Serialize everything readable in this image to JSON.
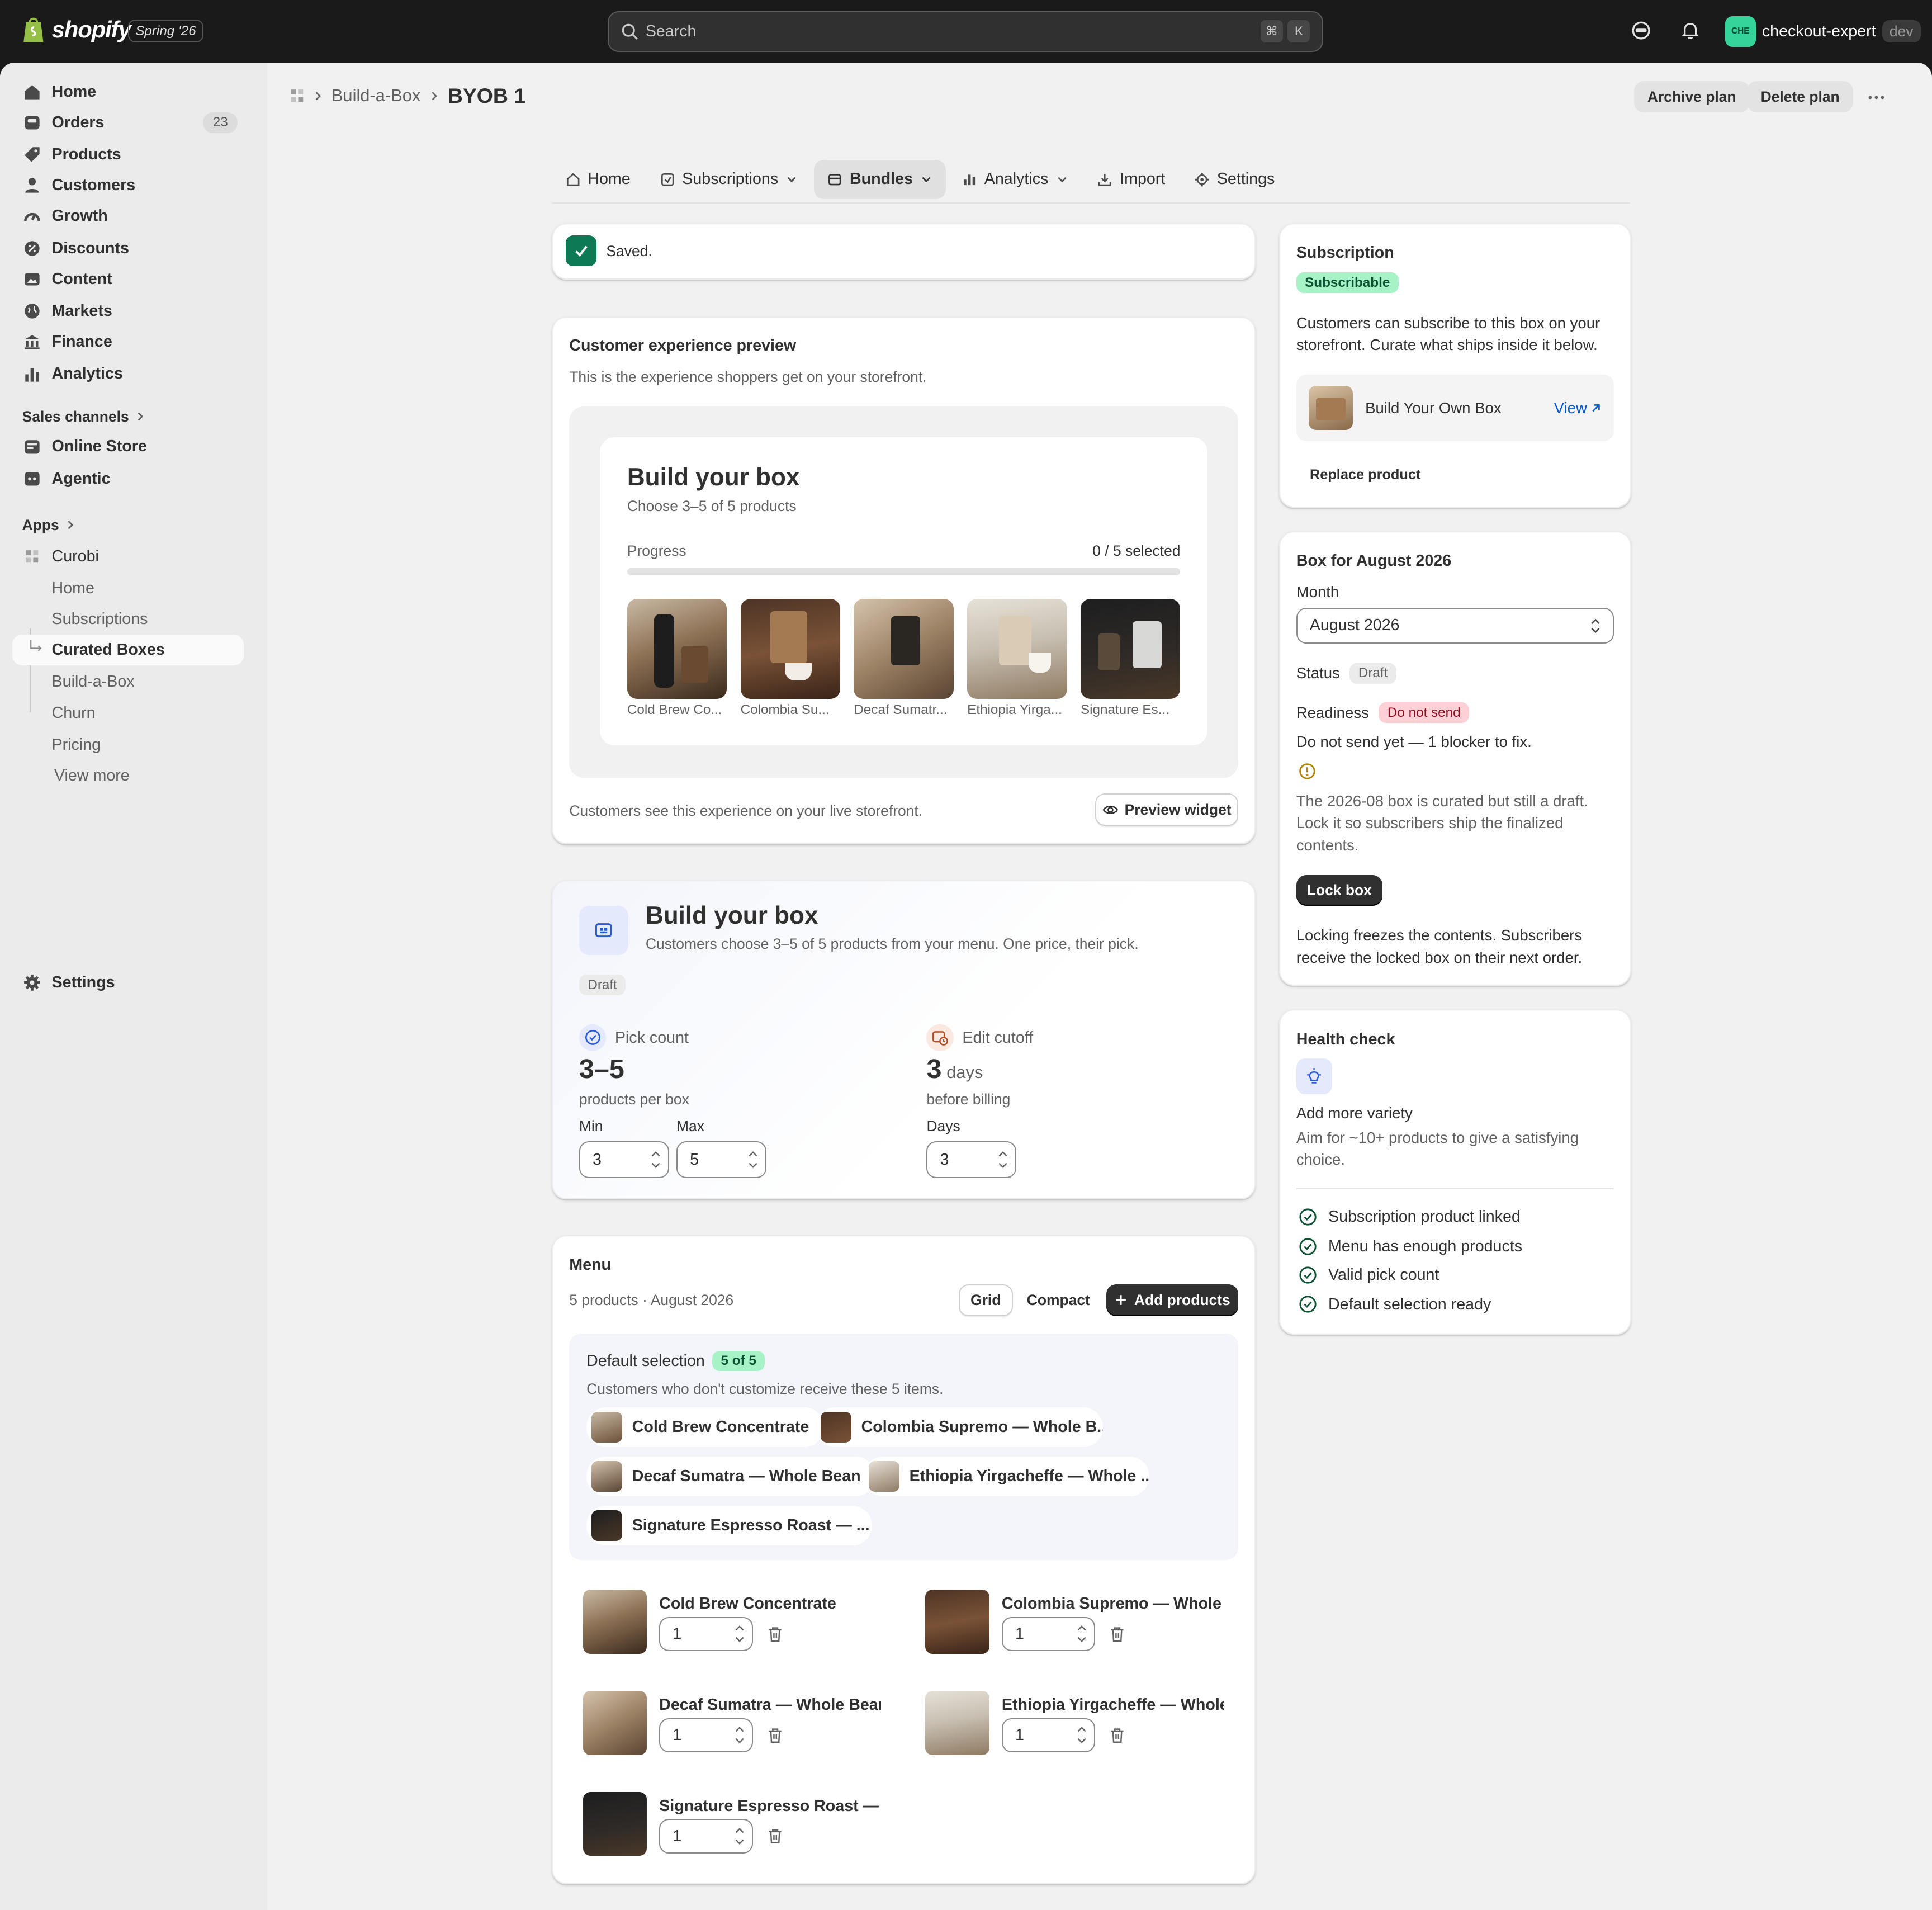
{
  "topbar": {
    "logo_text": "shopify",
    "edition": "Spring '26",
    "search_placeholder": "Search",
    "kbd1": "⌘",
    "kbd2": "K",
    "store_initials": "CHE",
    "store_name": "checkout-expert",
    "store_env": "dev"
  },
  "sidebar": {
    "items": [
      {
        "label": "Home",
        "icon": "home-icon"
      },
      {
        "label": "Orders",
        "icon": "inbox-icon",
        "count": "23"
      },
      {
        "label": "Products",
        "icon": "tag-icon"
      },
      {
        "label": "Customers",
        "icon": "person-icon"
      },
      {
        "label": "Growth",
        "icon": "gauge-icon"
      },
      {
        "label": "Discounts",
        "icon": "discount-icon"
      },
      {
        "label": "Content",
        "icon": "content-icon"
      },
      {
        "label": "Markets",
        "icon": "globe-icon"
      },
      {
        "label": "Finance",
        "icon": "bank-icon"
      },
      {
        "label": "Analytics",
        "icon": "bar-chart-icon"
      }
    ],
    "sales_channels_label": "Sales channels",
    "channels": [
      {
        "label": "Online Store",
        "icon": "store-icon"
      },
      {
        "label": "Agentic",
        "icon": "agentic-icon"
      }
    ],
    "apps_label": "Apps",
    "app_name": "Curobi",
    "app_items": [
      "Home",
      "Subscriptions",
      "Curated Boxes",
      "Build-a-Box",
      "Churn",
      "Pricing",
      "View more"
    ],
    "settings_label": "Settings"
  },
  "header": {
    "breadcrumb_parent": "Build-a-Box",
    "title": "BYOB 1",
    "archive_label": "Archive plan",
    "delete_label": "Delete plan"
  },
  "tabs": [
    {
      "label": "Home",
      "icon": "home-outline-icon",
      "dropdown": false
    },
    {
      "label": "Subscriptions",
      "icon": "subscriptions-icon",
      "dropdown": true
    },
    {
      "label": "Bundles",
      "icon": "bundles-icon",
      "dropdown": true,
      "active": true
    },
    {
      "label": "Analytics",
      "icon": "analytics-icon",
      "dropdown": true
    },
    {
      "label": "Import",
      "icon": "import-icon",
      "dropdown": false
    },
    {
      "label": "Settings",
      "icon": "settings-outline-icon",
      "dropdown": false
    }
  ],
  "saved": {
    "text": "Saved."
  },
  "preview": {
    "title": "Customer experience preview",
    "subtitle": "This is the experience shoppers get on your storefront.",
    "widget_title": "Build your box",
    "widget_sub": "Choose 3–5 of 5 products",
    "progress_label": "Progress",
    "progress_count": "0 / 5 selected",
    "progress_value": 0,
    "products": [
      "Cold Brew Co...",
      "Colombia Su...",
      "Decaf Sumatr...",
      "Ethiopia Yirga...",
      "Signature Es..."
    ],
    "footer": "Customers see this experience on your live storefront.",
    "preview_button": "Preview widget"
  },
  "box": {
    "title": "Build your box",
    "subtitle": "Customers choose 3–5 of 5 products from your menu. One price, their pick.",
    "status": "Draft",
    "pick_label": "Pick count",
    "pick_value": "3–5",
    "pick_sub": "products per box",
    "min_label": "Min",
    "min_value": "3",
    "max_label": "Max",
    "max_value": "5",
    "cutoff_label": "Edit cutoff",
    "cutoff_value": "3",
    "cutoff_unit": "days",
    "cutoff_sub": "before billing",
    "days_label": "Days",
    "days_value": "3"
  },
  "menu": {
    "title": "Menu",
    "subtitle": "5 products · August 2026",
    "grid_label": "Grid",
    "compact_label": "Compact",
    "add_label": "Add products",
    "default_title": "Default selection",
    "default_badge": "5 of 5",
    "default_desc": "Customers who don't customize receive these 5 items.",
    "chips": [
      "Cold Brew Concentrate",
      "Colombia Supremo — Whole B...",
      "Decaf Sumatra — Whole Bean",
      "Ethiopia Yirgacheffe — Whole ...",
      "Signature Espresso Roast — ..."
    ],
    "items": [
      {
        "name": "Cold Brew Concentrate",
        "qty": "1"
      },
      {
        "name": "Colombia Supremo — Whole ...",
        "qty": "1"
      },
      {
        "name": "Decaf Sumatra — Whole Bean",
        "qty": "1"
      },
      {
        "name": "Ethiopia Yirgacheffe — Whole...",
        "qty": "1"
      },
      {
        "name": "Signature Espresso Roast — ...",
        "qty": "1"
      }
    ]
  },
  "subscription": {
    "title": "Subscription",
    "badge": "Subscribable",
    "desc": "Customers can subscribe to this box on your storefront. Curate what ships inside it below.",
    "product": "Build Your Own Box",
    "view": "View",
    "replace": "Replace product"
  },
  "month_box": {
    "title": "Box for August 2026",
    "month_label": "Month",
    "month_value": "August 2026",
    "status_label": "Status",
    "status_value": "Draft",
    "readiness_label": "Readiness",
    "readiness_value": "Do not send",
    "blocker": "Do not send yet — 1 blocker to fix.",
    "warning": "The 2026-08 box is curated but still a draft. Lock it so subscribers ship the finalized contents.",
    "lock_label": "Lock box",
    "lock_desc": "Locking freezes the contents. Subscribers receive the locked box on their next order."
  },
  "health": {
    "title": "Health check",
    "tip_title": "Add more variety",
    "tip_desc": "Aim for ~10+ products to give a satisfying choice.",
    "checks": [
      "Subscription product linked",
      "Menu has enough products",
      "Valid pick count",
      "Default selection ready"
    ]
  },
  "colors": {
    "topbar": "#1a1a1a",
    "success": "#0c5132",
    "accent_link": "#005bd3",
    "badge_green": "#a7f3c7",
    "badge_red": "#fed1d7"
  }
}
